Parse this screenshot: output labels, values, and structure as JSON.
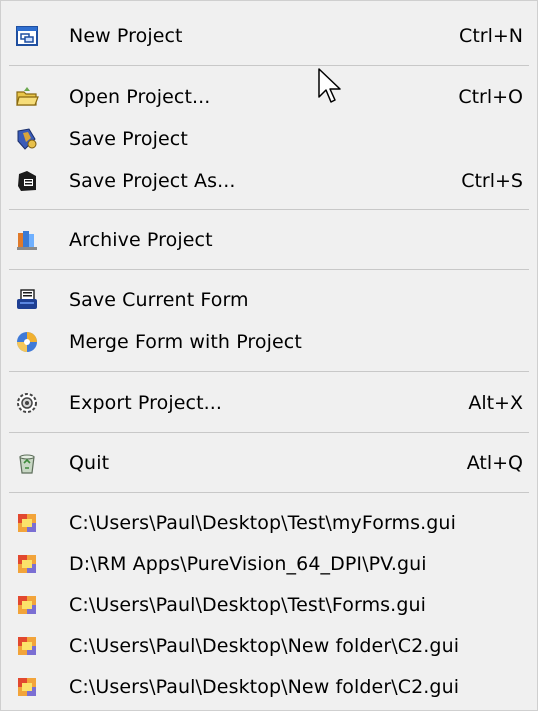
{
  "menu": {
    "items": [
      {
        "label": "New Project",
        "shortcut": "Ctrl+N",
        "icon": "new-project-icon"
      },
      {
        "label": "Open Project...",
        "shortcut": "Ctrl+O",
        "icon": "open-folder-icon"
      },
      {
        "label": "Save Project",
        "shortcut": "",
        "icon": "save-project-icon"
      },
      {
        "label": "Save Project As...",
        "shortcut": "Ctrl+S",
        "icon": "save-as-icon"
      },
      {
        "label": "Archive Project",
        "shortcut": "",
        "icon": "archive-icon"
      },
      {
        "label": "Save Current Form",
        "shortcut": "",
        "icon": "save-form-icon"
      },
      {
        "label": "Merge Form with Project",
        "shortcut": "",
        "icon": "merge-icon"
      },
      {
        "label": "Export Project...",
        "shortcut": "Alt+X",
        "icon": "export-gear-icon"
      },
      {
        "label": "Quit",
        "shortcut": "Atl+Q",
        "icon": "recycle-bin-icon"
      }
    ],
    "recent_files": [
      "C:\\Users\\Paul\\Desktop\\Test\\myForms.gui",
      "D:\\RM Apps\\PureVision_64_DPI\\PV.gui",
      "C:\\Users\\Paul\\Desktop\\Test\\Forms.gui",
      "C:\\Users\\Paul\\Desktop\\New folder\\C2.gui",
      "C:\\Users\\Paul\\Desktop\\New folder\\C2.gui"
    ]
  },
  "cursor": {
    "icon": "mouse-pointer-icon"
  }
}
